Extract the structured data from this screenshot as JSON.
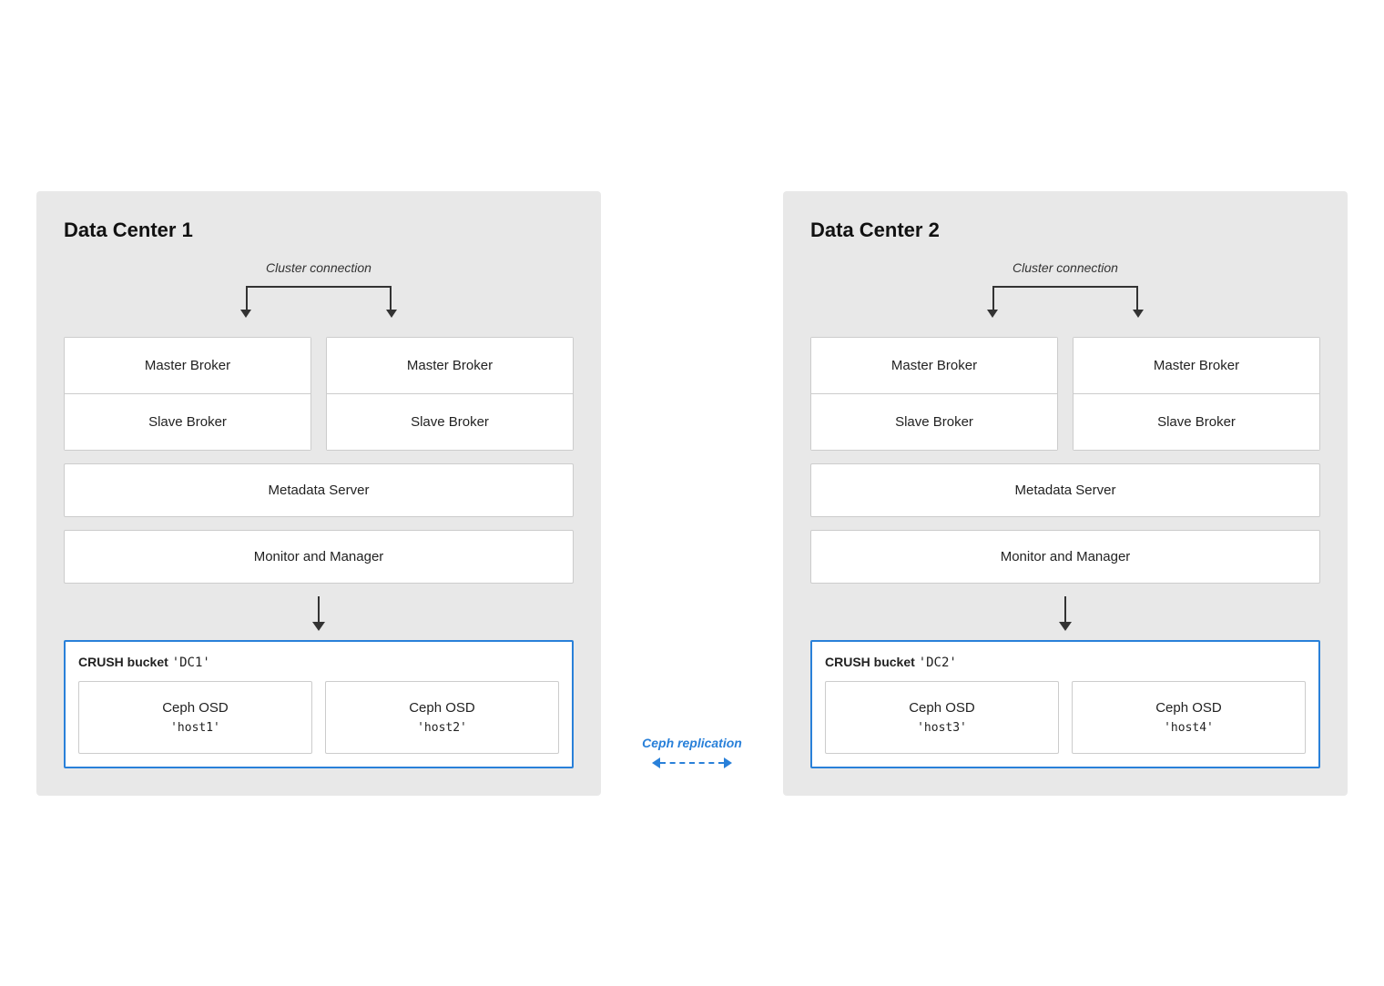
{
  "dc1": {
    "title": "Data Center 1",
    "cluster_connection": "Cluster connection",
    "brokers": [
      {
        "master": "Master Broker",
        "slave": "Slave Broker"
      },
      {
        "master": "Master Broker",
        "slave": "Slave Broker"
      }
    ],
    "metadata_server": "Metadata Server",
    "monitor_manager": "Monitor and Manager",
    "crush_bucket_label": "CRUSH bucket",
    "crush_bucket_name": "'DC1'",
    "osds": [
      {
        "name": "Ceph OSD",
        "host": "'host1'"
      },
      {
        "name": "Ceph OSD",
        "host": "'host2'"
      }
    ]
  },
  "dc2": {
    "title": "Data Center 2",
    "cluster_connection": "Cluster connection",
    "brokers": [
      {
        "master": "Master Broker",
        "slave": "Slave Broker"
      },
      {
        "master": "Master Broker",
        "slave": "Slave Broker"
      }
    ],
    "metadata_server": "Metadata Server",
    "monitor_manager": "Monitor and Manager",
    "crush_bucket_label": "CRUSH bucket",
    "crush_bucket_name": "'DC2'",
    "osds": [
      {
        "name": "Ceph OSD",
        "host": "'host3'"
      },
      {
        "name": "Ceph OSD",
        "host": "'host4'"
      }
    ]
  },
  "replication": {
    "label": "Ceph replication"
  }
}
